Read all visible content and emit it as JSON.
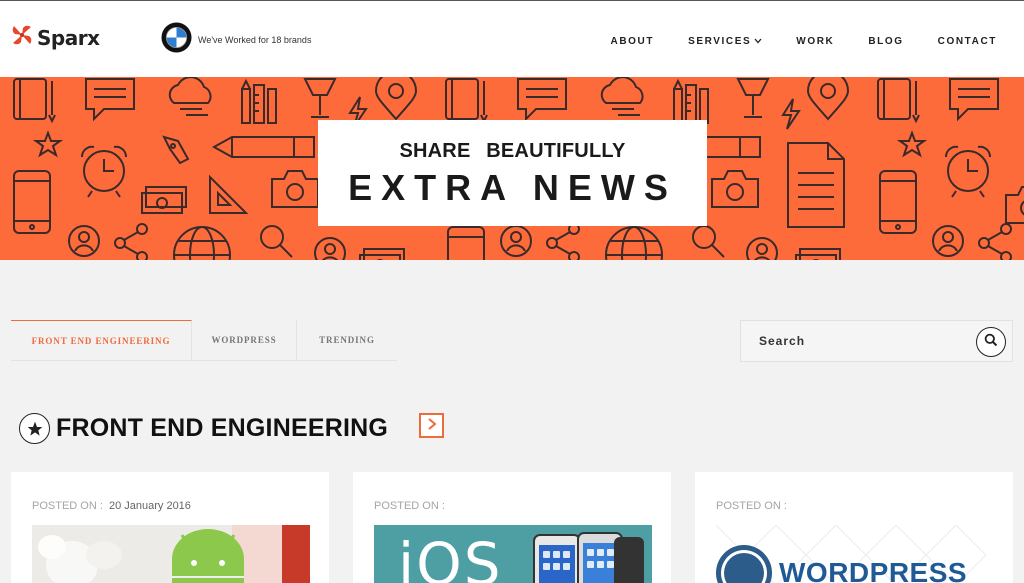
{
  "header": {
    "logo_text": "Sparx",
    "brand_badge_text": "We've Worked for 18 brands",
    "nav": [
      {
        "label": "ABOUT"
      },
      {
        "label": "SERVICES"
      },
      {
        "label": "WORK"
      },
      {
        "label": "BLOG"
      },
      {
        "label": "CONTACT"
      }
    ]
  },
  "banner": {
    "subtitle": "SHARE BEAUTIFULLY",
    "title": "EXTRA NEWS"
  },
  "tabs": [
    {
      "label": "FRONT END ENGINEERING",
      "active": true
    },
    {
      "label": "WORDPRESS",
      "active": false
    },
    {
      "label": "TRENDING",
      "active": false
    }
  ],
  "search": {
    "placeholder": "Search",
    "value": ""
  },
  "section": {
    "title": "FRONT END ENGINEERING"
  },
  "cards": [
    {
      "posted_label": "POSTED ON :",
      "date": "20 January 2016",
      "image": "android-figure"
    },
    {
      "posted_label": "POSTED ON :",
      "date": "",
      "image_text": "iOS",
      "image": "iphones"
    },
    {
      "posted_label": "POSTED ON :",
      "date": "",
      "image_text": "WordPress",
      "image": "wordpress-logo"
    }
  ],
  "colors": {
    "accent": "#f06a3c",
    "banner": "#fe6b3b",
    "icon_stroke": "#3a2a2a"
  }
}
